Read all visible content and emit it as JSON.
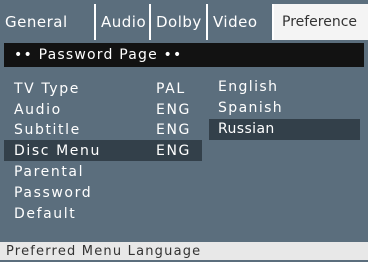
{
  "tabs": [
    {
      "label": "General"
    },
    {
      "label": "Audio"
    },
    {
      "label": "Dolby"
    },
    {
      "label": "Video"
    },
    {
      "label": "Preference"
    }
  ],
  "header": {
    "title": "•• Password Page ••"
  },
  "menu": {
    "items": [
      {
        "label": "TV Type",
        "value": "PAL"
      },
      {
        "label": "Audio",
        "value": "ENG"
      },
      {
        "label": "Subtitle",
        "value": "ENG"
      },
      {
        "label": "Disc Menu",
        "value": "ENG"
      },
      {
        "label": "Parental",
        "value": ""
      },
      {
        "label": "Password",
        "value": ""
      },
      {
        "label": "Default",
        "value": ""
      }
    ]
  },
  "options": {
    "items": [
      "English",
      "Spanish",
      "Russian"
    ]
  },
  "status": {
    "text": "Preferred Menu Language"
  },
  "colors": {
    "background": "#5b6e7d",
    "header": "#121212",
    "highlight": "#33404a",
    "active_tab": "#f4f4f4",
    "status_bar": "#e8e8e8"
  }
}
